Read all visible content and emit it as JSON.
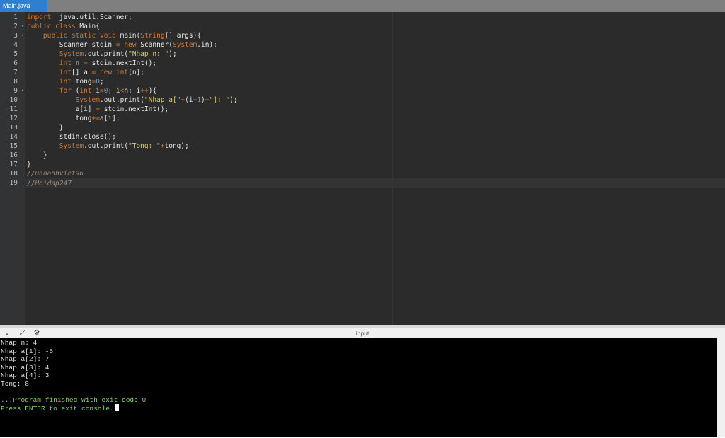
{
  "tab": {
    "label": "Main.java"
  },
  "editor": {
    "line_numbers": [
      "1",
      "2",
      "3",
      "4",
      "5",
      "6",
      "7",
      "8",
      "9",
      "10",
      "11",
      "12",
      "13",
      "14",
      "15",
      "16",
      "17",
      "18",
      "19"
    ],
    "fold_markers_on_lines": [
      2,
      3,
      9
    ],
    "active_line": 19,
    "lines": [
      [
        [
          "kw",
          "import"
        ],
        [
          "",
          "  java.util.Scanner;"
        ]
      ],
      [
        [
          "kw",
          "public"
        ],
        [
          "",
          " "
        ],
        [
          "kw",
          "class"
        ],
        [
          "",
          " Main{"
        ]
      ],
      [
        [
          "",
          "    "
        ],
        [
          "kw",
          "public"
        ],
        [
          "",
          " "
        ],
        [
          "kw",
          "static"
        ],
        [
          "",
          " "
        ],
        [
          "kw",
          "void"
        ],
        [
          "",
          " main("
        ],
        [
          "sys",
          "String"
        ],
        [
          "",
          "[] args){"
        ]
      ],
      [
        [
          "",
          "        Scanner stdin "
        ],
        [
          "op",
          "="
        ],
        [
          "",
          " "
        ],
        [
          "kw",
          "new"
        ],
        [
          "",
          " Scanner("
        ],
        [
          "sys",
          "System"
        ],
        [
          "",
          ".in);"
        ]
      ],
      [
        [
          "",
          "        "
        ],
        [
          "sys",
          "System"
        ],
        [
          "",
          ".out.print("
        ],
        [
          "str",
          "\"Nhap n: \""
        ],
        [
          "",
          ");"
        ]
      ],
      [
        [
          "",
          "        "
        ],
        [
          "ty",
          "int"
        ],
        [
          "",
          " n "
        ],
        [
          "op",
          "="
        ],
        [
          "",
          " stdin.nextInt();"
        ]
      ],
      [
        [
          "",
          "        "
        ],
        [
          "ty",
          "int"
        ],
        [
          "",
          "[] a "
        ],
        [
          "op",
          "="
        ],
        [
          "",
          " "
        ],
        [
          "kw",
          "new"
        ],
        [
          "",
          " "
        ],
        [
          "ty",
          "int"
        ],
        [
          "",
          "[n];"
        ]
      ],
      [
        [
          "",
          "        "
        ],
        [
          "ty",
          "int"
        ],
        [
          "",
          " tong"
        ],
        [
          "op",
          "="
        ],
        [
          "num",
          "0"
        ],
        [
          "",
          ";"
        ]
      ],
      [
        [
          "",
          "        "
        ],
        [
          "kw",
          "for"
        ],
        [
          "",
          " ("
        ],
        [
          "ty",
          "int"
        ],
        [
          "",
          " i"
        ],
        [
          "op",
          "="
        ],
        [
          "num",
          "0"
        ],
        [
          "",
          "; i"
        ],
        [
          "op",
          "<"
        ],
        [
          "",
          "n; i"
        ],
        [
          "op",
          "++"
        ],
        [
          "",
          "){"
        ]
      ],
      [
        [
          "",
          "            "
        ],
        [
          "sys",
          "System"
        ],
        [
          "",
          ".out.print("
        ],
        [
          "str",
          "\"Nhap a[\""
        ],
        [
          "op",
          "+"
        ],
        [
          "",
          "(i"
        ],
        [
          "op",
          "+"
        ],
        [
          "num",
          "1"
        ],
        [
          "",
          ")"
        ],
        [
          "op",
          "+"
        ],
        [
          "str",
          "\"]: \""
        ],
        [
          "",
          ");"
        ]
      ],
      [
        [
          "",
          "            a[i] "
        ],
        [
          "op",
          "="
        ],
        [
          "",
          " stdin.nextInt();"
        ]
      ],
      [
        [
          "",
          "            tong"
        ],
        [
          "op",
          "+="
        ],
        [
          "",
          "a[i];"
        ]
      ],
      [
        [
          "",
          "        }"
        ]
      ],
      [
        [
          "",
          "        stdin.close();"
        ]
      ],
      [
        [
          "",
          "        "
        ],
        [
          "sys",
          "System"
        ],
        [
          "",
          ".out.print("
        ],
        [
          "str",
          "\"Tong: \""
        ],
        [
          "op",
          "+"
        ],
        [
          "",
          "tong);"
        ]
      ],
      [
        [
          "",
          "    }"
        ]
      ],
      [
        [
          "",
          "}"
        ]
      ],
      [
        [
          "cm",
          "//Daoanhviet96"
        ]
      ],
      [
        [
          "cm",
          "//Hoidap247"
        ]
      ]
    ]
  },
  "console_header": {
    "label": "input",
    "icons": [
      "chevron-down-icon",
      "expand-icon",
      "settings-icon"
    ],
    "icon_glyphs": [
      "⌄",
      "⤢",
      "⚙"
    ]
  },
  "console": {
    "lines": [
      {
        "text": "Nhap n: 4",
        "color": "#e0e0e0"
      },
      {
        "text": "Nhap a[1]: -6",
        "color": "#e0e0e0"
      },
      {
        "text": "Nhap a[2]: 7",
        "color": "#e0e0e0"
      },
      {
        "text": "Nhap a[3]: 4",
        "color": "#e0e0e0"
      },
      {
        "text": "Nhap a[4]: 3",
        "color": "#e0e0e0"
      },
      {
        "text": "Tong: 8",
        "color": "#e0e0e0"
      },
      {
        "text": "",
        "color": "#e0e0e0"
      },
      {
        "text": "...Program finished with exit code 0",
        "color": "#7fd85a"
      },
      {
        "text": "Press ENTER to exit console.",
        "color": "#7fd85a"
      }
    ]
  },
  "colors": {
    "tab_active": "#2f7fd1",
    "editor_bg": "#2b2b2b",
    "console_bg": "#000000",
    "console_green": "#7fd85a"
  }
}
